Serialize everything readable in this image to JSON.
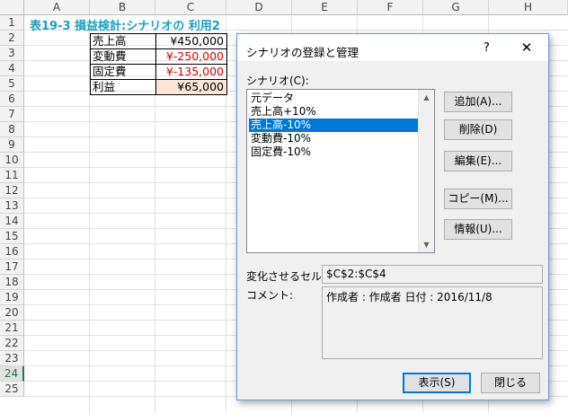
{
  "sheet": {
    "columns": [
      "A",
      "B",
      "C",
      "D",
      "E",
      "F",
      "G",
      "H"
    ],
    "rows": [
      "1",
      "2",
      "3",
      "4",
      "5",
      "6",
      "7",
      "8",
      "9",
      "10",
      "11",
      "12",
      "13",
      "14",
      "15",
      "16",
      "17",
      "18",
      "19",
      "20",
      "21",
      "22",
      "23",
      "24",
      "25"
    ],
    "active_row": "24",
    "title": "表19-3  損益検計:シナリオの 利用2",
    "cells": [
      {
        "label": "売上高",
        "value": "¥450,000",
        "negative": false
      },
      {
        "label": "変動費",
        "value": "¥-250,000",
        "negative": true
      },
      {
        "label": "固定費",
        "value": "¥-135,000",
        "negative": true
      },
      {
        "label": "利益",
        "value": "¥65,000",
        "negative": false
      }
    ],
    "colors": {
      "title": "#1a9fc4",
      "negative": "#e00000",
      "profit_fill": "#fbe5d6",
      "grid": "#e1e1e1"
    }
  },
  "dialog": {
    "title": "シナリオの登録と管理",
    "help": "?",
    "close": "✕",
    "list_label": "シナリオ(C):",
    "scenarios": [
      "元データ",
      "売上高+10%",
      "売上高-10%",
      "変動費-10%",
      "固定費-10%"
    ],
    "selected_index": 2,
    "buttons": {
      "add": "追加(A)...",
      "delete": "削除(D)",
      "edit": "編集(E)...",
      "copy": "コピー(M)...",
      "info": "情報(U)...",
      "show": "表示(S)",
      "close": "閉じる"
    },
    "changing_cells_label": "変化させるセル:",
    "changing_cells_value": "$C$2:$C$4",
    "comment_label": "コメント:",
    "comment_value": "作成者 : 作成者 日付 : 2016/11/8",
    "scroll_up_icon": "▲",
    "scroll_down_icon": "▼",
    "accent": "#0078d7"
  }
}
